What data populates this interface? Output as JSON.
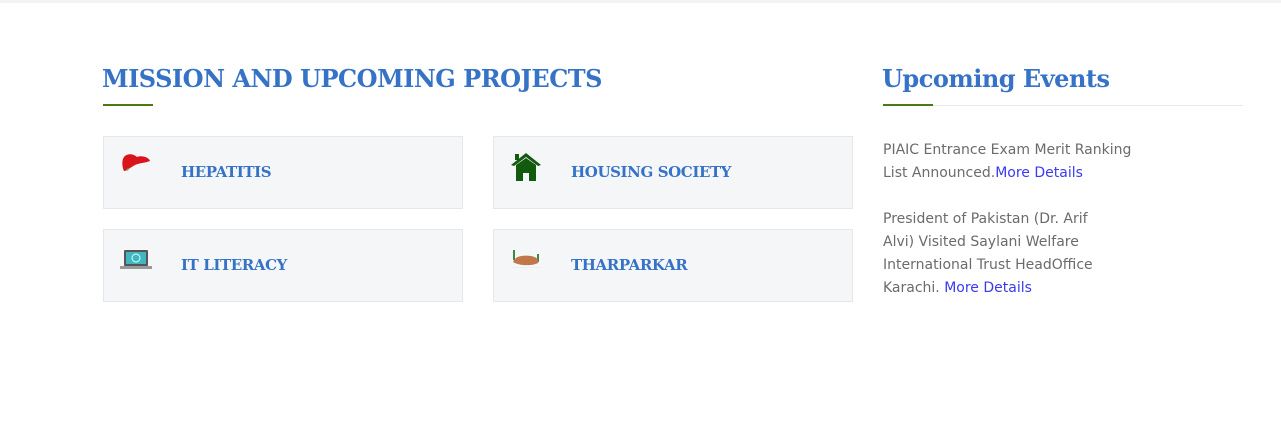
{
  "mission": {
    "title": "MISSION AND UPCOMING PROJECTS",
    "projects": [
      {
        "label": "HEPATITIS",
        "icon": "liver-icon"
      },
      {
        "label": "HOUSING SOCIETY",
        "icon": "house-icon"
      },
      {
        "label": "IT LITERACY",
        "icon": "laptop-icon"
      },
      {
        "label": "THARPARKAR",
        "icon": "desert-icon"
      }
    ]
  },
  "events": {
    "title": "Upcoming Events",
    "items": [
      {
        "text": "PIAIC Entrance Exam Merit Ranking List Announced.",
        "link": "More Details"
      },
      {
        "text": "President of Pakistan (Dr. Arif Alvi) Visited Saylani Welfare International Trust HeadOffice Karachi. ",
        "link": "More Details"
      }
    ]
  },
  "colors": {
    "heading": "#3673c6",
    "underline": "#4a7a12",
    "link": "#3a3af0"
  }
}
